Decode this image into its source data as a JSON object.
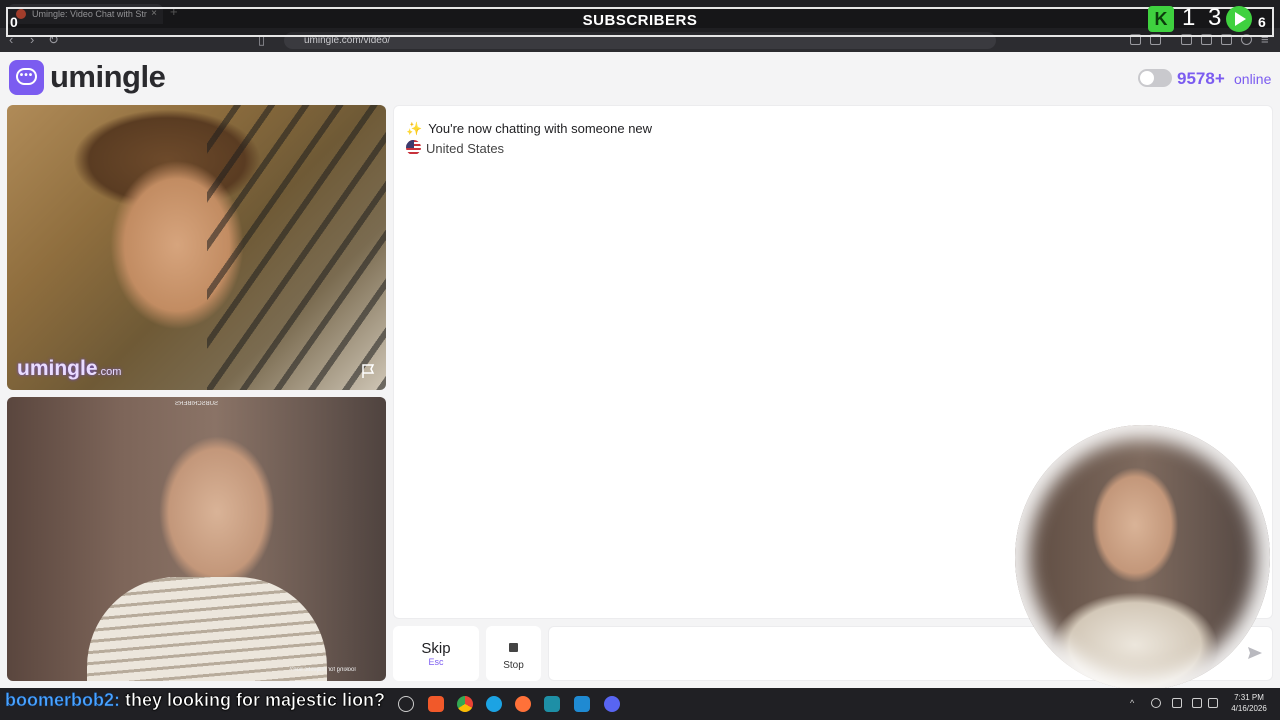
{
  "browser": {
    "tab_title": "Umingle: Video Chat with Str",
    "tab_close": "×",
    "new_tab": "+",
    "url": "umingle.com/video/"
  },
  "overlay": {
    "title": "SUBSCRIBERS",
    "left_count": "0",
    "center_count": "1 3",
    "right_count": "6",
    "k_logo": "K",
    "accent_color": "#3fd13f"
  },
  "app": {
    "logo_text": "umingle",
    "logo_dots": "•••",
    "brand_color": "#7b5cf0",
    "online_count": "9578+",
    "online_label": "online"
  },
  "stranger_video": {
    "watermark": "umingle",
    "watermark_suffix": ".com",
    "report_icon": "flag-icon"
  },
  "self_video": {
    "mirrored_title": "SUBSCRIBERS",
    "mirrored_caption": "looking for majestic lion?"
  },
  "chat": {
    "status": "You're now chatting with someone new",
    "country": "United States"
  },
  "controls": {
    "skip_label": "Skip",
    "skip_hint": "Esc",
    "stop_label": "Stop",
    "message_placeholder": "",
    "send_icon": "send-icon"
  },
  "stream_chat": {
    "user": "boomerbob2:",
    "message": "they looking for majestic lion?"
  },
  "taskbar": {
    "time": "7:31 PM",
    "date": "4/16/2026"
  }
}
